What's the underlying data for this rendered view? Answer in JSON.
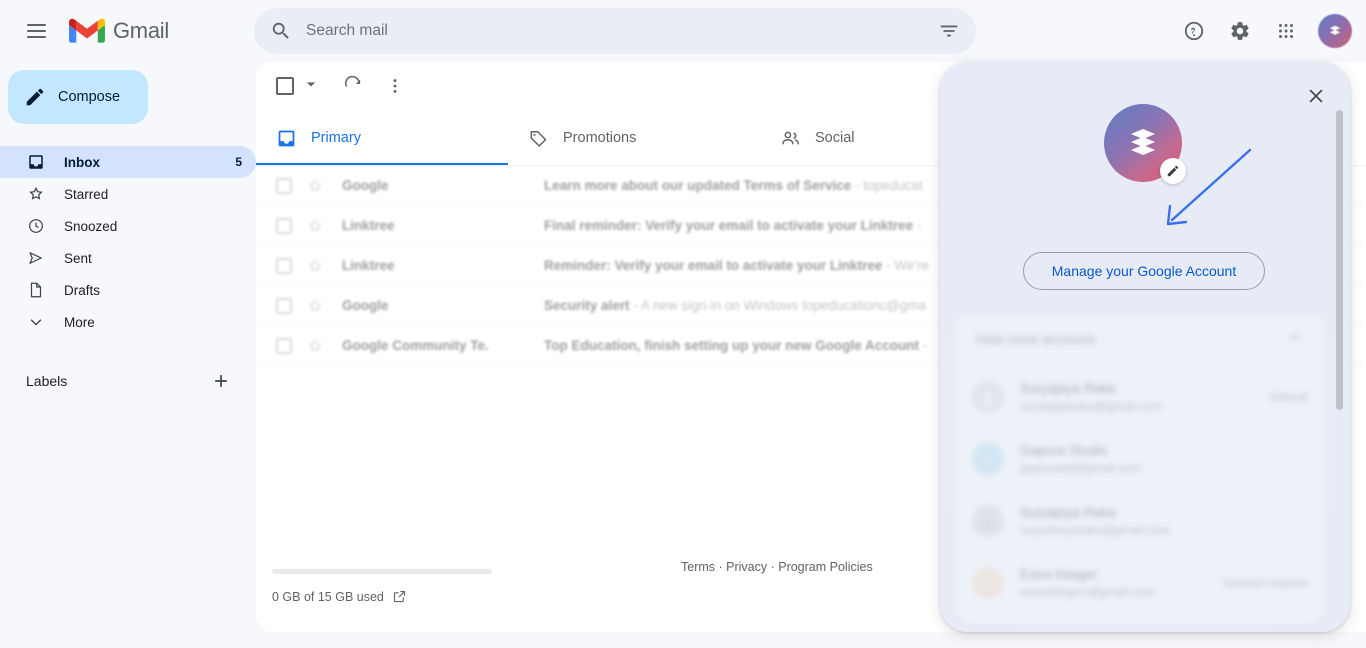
{
  "app": {
    "name": "Gmail"
  },
  "header": {
    "menu_label": "Main menu",
    "search": {
      "placeholder": "Search mail",
      "value": ""
    },
    "icons": {
      "help": "help-icon",
      "settings": "gear-icon",
      "apps": "apps-grid-icon",
      "avatar": "account-avatar"
    }
  },
  "sidebar": {
    "compose_label": "Compose",
    "items": [
      {
        "label": "Inbox",
        "icon": "inbox-icon",
        "count": "5",
        "active": true
      },
      {
        "label": "Starred",
        "icon": "star-icon",
        "count": "",
        "active": false
      },
      {
        "label": "Snoozed",
        "icon": "clock-icon",
        "count": "",
        "active": false
      },
      {
        "label": "Sent",
        "icon": "send-icon",
        "count": "",
        "active": false
      },
      {
        "label": "Drafts",
        "icon": "draft-icon",
        "count": "",
        "active": false
      },
      {
        "label": "More",
        "icon": "chevron-down-icon",
        "count": "",
        "active": false
      }
    ],
    "labels_title": "Labels",
    "labels_add": "plus-icon"
  },
  "toolbar": {
    "select_all": "select-all-checkbox",
    "refresh": "refresh-icon",
    "more": "more-vertical-icon"
  },
  "tabs": [
    {
      "label": "Primary",
      "icon": "inbox-tab-icon",
      "active": true
    },
    {
      "label": "Promotions",
      "icon": "tag-icon",
      "active": false
    },
    {
      "label": "Social",
      "icon": "people-icon",
      "active": false
    }
  ],
  "emails": [
    {
      "sender": "Google",
      "subject": "Learn more about our updated Terms of Service",
      "snippet": "topeducat"
    },
    {
      "sender": "Linktree",
      "subject": "Final reminder: Verify your email to activate your Linktree",
      "snippet": ""
    },
    {
      "sender": "Linktree",
      "subject": "Reminder: Verify your email to activate your Linktree",
      "snippet": "We're"
    },
    {
      "sender": "Google",
      "subject": "Security alert",
      "snippet": "A new sign-in on Windows topeducationc@gma"
    },
    {
      "sender": "Google Community Te.",
      "subject": "Top Education, finish setting up your new Google Account",
      "snippet": ""
    }
  ],
  "footer": {
    "storage_text": "0 GB of 15 GB used",
    "storage_link_icon": "external-link-icon",
    "legal": "Terms · Privacy · Program Policies",
    "terms": "Terms",
    "privacy": "Privacy",
    "policies": "Program Policies",
    "separator": " · "
  },
  "popup": {
    "close_icon": "close-icon",
    "avatar_icon": "brand-logo-avatar",
    "edit_icon": "pencil-edit-icon",
    "manage_label": "Manage your Google Account",
    "hide_accounts_label": "Hide more accounts",
    "hide_accounts_icon": "chevron-up-icon",
    "accounts": [
      {
        "name": "Suryajaya Raka",
        "email": "suryajayaraka@gmail.com",
        "tag": "Default",
        "color": "#d8d8d8",
        "initial": ""
      },
      {
        "name": "Gapura Studio",
        "email": "gapurastd@gmail.com",
        "tag": "",
        "color": "#a6dcf0",
        "initial": "n"
      },
      {
        "name": "Suryajaya Raka",
        "email": "suryaheryaraka@gmail.com",
        "tag": "",
        "color": "#d0d0d0",
        "initial": ""
      },
      {
        "name": "Extra Integer",
        "email": "extraintegerr@gmail.com",
        "tag": "Session expired",
        "color": "#fbd9b5",
        "initial": "E"
      }
    ]
  },
  "colors": {
    "accent_blue": "#1a73e8",
    "link_blue": "#0b57d0",
    "arrow_blue": "#3b6ef0",
    "compose_bg": "#c2e7ff",
    "active_nav_bg": "#d3e3fd",
    "page_bg": "#f6f8fc",
    "popup_bg": "#e6ebf5",
    "panel_bg": "#ffffff"
  }
}
